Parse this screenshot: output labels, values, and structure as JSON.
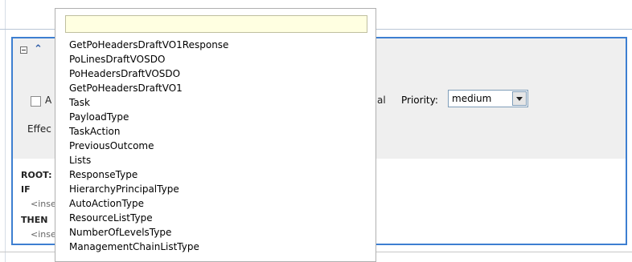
{
  "rule_panel": {
    "checkbox_label_partial": "A",
    "effective_label_partial": "Effec",
    "label_suffix_partial": "al",
    "priority_label": "Priority:",
    "priority_value": "medium",
    "sections": {
      "root": "ROOT:",
      "if": "IF",
      "insert_if": "<inse",
      "then": "THEN",
      "insert_then": "<inse"
    }
  },
  "dropdown": {
    "filter_value": "",
    "options": [
      "GetPoHeadersDraftVO1Response",
      "PoLinesDraftVOSDO",
      "PoHeadersDraftVOSDO",
      "GetPoHeadersDraftVO1",
      "Task",
      "PayloadType",
      "TaskAction",
      "PreviousOutcome",
      "Lists",
      "ResponseType",
      "HierarchyPrincipalType",
      "AutoActionType",
      "ResourceListType",
      "NumberOfLevelsType",
      "ManagementChainListType"
    ]
  },
  "colors": {
    "panel_border": "#3d7fd1",
    "filter_bg": "#ffffe1",
    "header_bg": "#efefef"
  }
}
